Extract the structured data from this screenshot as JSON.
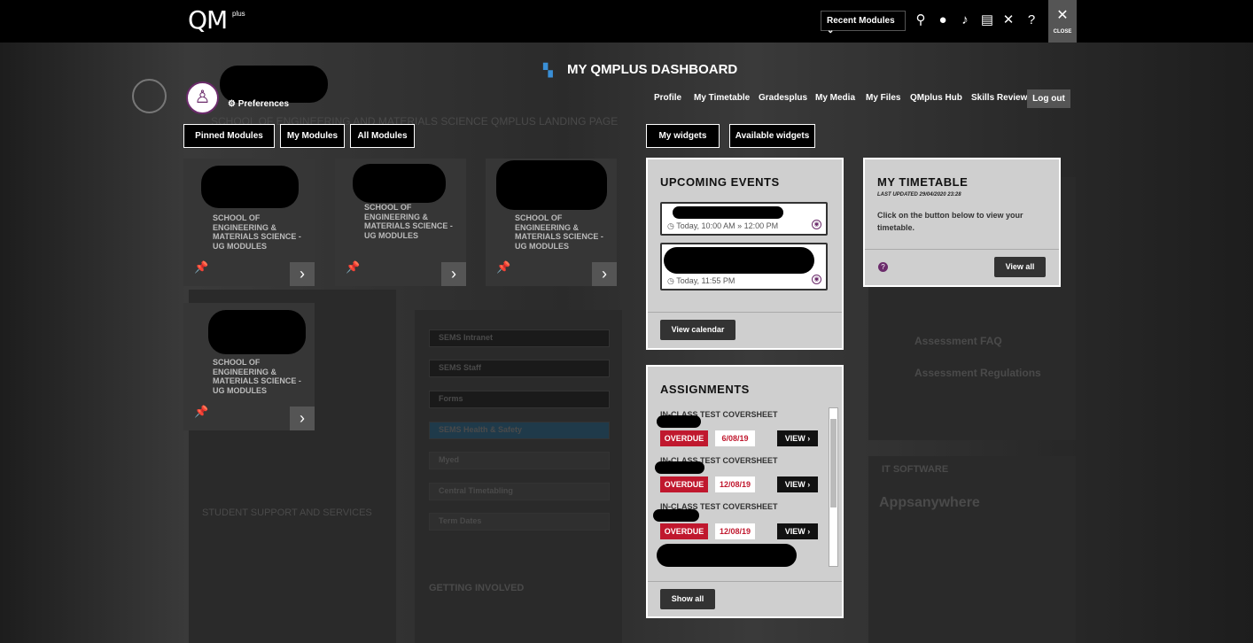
{
  "topbar": {
    "logo": "QM",
    "logo_sub": "plus",
    "recent_label": "Recent Modules",
    "close_label": "CLOSE"
  },
  "profile": {
    "preferences": "Preferences"
  },
  "dashboard": {
    "title": "MY QMPLUS DASHBOARD",
    "nav": [
      "Profile",
      "My Timetable",
      "Gradesplus",
      "My Media",
      "My Files",
      "QMplus Hub",
      "Skills Review"
    ],
    "logout": "Log out"
  },
  "module_tabs": [
    "Pinned Modules",
    "My Modules",
    "All Modules"
  ],
  "widget_tabs": [
    "My widgets",
    "Available widgets"
  ],
  "modules": [
    {
      "name": "SCHOOL OF ENGINEERING & MATERIALS SCIENCE - UG MODULES"
    },
    {
      "name": "SCHOOL OF ENGINEERING & MATERIALS SCIENCE - UG MODULES"
    },
    {
      "name": "SCHOOL OF ENGINEERING & MATERIALS SCIENCE - UG MODULES"
    },
    {
      "name": "SCHOOL OF ENGINEERING & MATERIALS SCIENCE - UG MODULES"
    }
  ],
  "upcoming": {
    "title": "UPCOMING EVENTS",
    "events": [
      {
        "time": "Today, 10:00 AM » 12:00 PM"
      },
      {
        "time": "Today, 11:55 PM"
      }
    ],
    "button": "View calendar"
  },
  "timetable": {
    "title": "MY TIMETABLE",
    "updated": "LAST UPDATED 29/04/2020 23:28",
    "text": "Click on the button below to view your timetable.",
    "button": "View all"
  },
  "assignments": {
    "title": "ASSIGNMENTS",
    "items": [
      {
        "name": "IN-CLASS TEST COVERSHEET",
        "status": "OVERDUE",
        "date": "6/08/19",
        "action": "VIEW"
      },
      {
        "name": "IN-CLASS TEST COVERSHEET",
        "status": "OVERDUE",
        "date": "12/08/19",
        "action": "VIEW"
      },
      {
        "name": "IN-CLASS TEST COVERSHEET",
        "status": "OVERDUE",
        "date": "12/08/19",
        "action": "VIEW"
      }
    ],
    "button": "Show all"
  },
  "background": {
    "landing": "SCHOOL OF ENGINEERING AND MATERIALS SCIENCE QMPLUS LANDING PAGE",
    "links": [
      "SEMS Intranet",
      "SEMS Staff",
      "Forms",
      "SEMS Health & Safety",
      "Myed",
      "Central Timetabling",
      "Term Dates"
    ],
    "support_title": "STUDENT SUPPORT AND SERVICES",
    "getting_involved": "GETTING INVOLVED",
    "it_software": "IT SOFTWARE",
    "appsanywhere": "Appsanywhere",
    "assessment_faq": "Assessment FAQ",
    "assessment_regs": "Assessment Regulations"
  }
}
